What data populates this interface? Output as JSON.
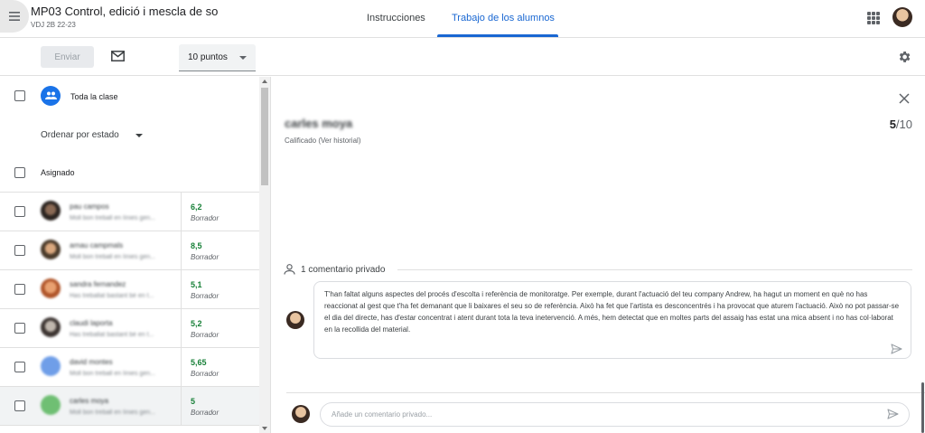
{
  "header": {
    "course_title": "MP03 Control, edició i mescla de so",
    "course_subtitle": "VDJ 2B 22-23",
    "tabs": [
      {
        "label": "Instrucciones",
        "active": false
      },
      {
        "label": "Trabajo de los alumnos",
        "active": true
      }
    ]
  },
  "toolbar": {
    "send_label": "Enviar",
    "points_value": "10 puntos"
  },
  "left_panel": {
    "all_class_label": "Toda la clase",
    "sort_label": "Ordenar por estado",
    "assigned_label": "Asignado",
    "students": [
      {
        "name": "pau campos",
        "preview": "Moll bon treball en línies gen...",
        "grade": "6,2",
        "status": "Borrador",
        "avatar": "a-dark",
        "selected": false
      },
      {
        "name": "arnau campmals",
        "preview": "Moll bon treball en línies gen...",
        "grade": "8,5",
        "status": "Borrador",
        "avatar": "a-warm",
        "selected": false
      },
      {
        "name": "sandra fernandez",
        "preview": "Has treballat bastant bé en t...",
        "grade": "5,1",
        "status": "Borrador",
        "avatar": "a-orange",
        "selected": false
      },
      {
        "name": "claudi laporta",
        "preview": "Has treballat bastant bé en t...",
        "grade": "5,2",
        "status": "Borrador",
        "avatar": "a-gray",
        "selected": false
      },
      {
        "name": "david montes",
        "preview": "Moll bon treball en línies gen...",
        "grade": "5,65",
        "status": "Borrador",
        "avatar": "a-blue",
        "selected": false
      },
      {
        "name": "carles moya",
        "preview": "Moll bon treball en línies gen...",
        "grade": "5",
        "status": "Borrador",
        "avatar": "a-green",
        "selected": true
      }
    ]
  },
  "detail": {
    "student_name": "carles moya",
    "grade_value": "5",
    "grade_total": "/10",
    "status": "Calificado (Ver historial)",
    "comments_header": "1 comentario privado",
    "comment_text": "T'han faltat alguns aspectes del procés d'escolta i referència de monitoratge. Per exemple, durant l'actuació del teu company Andrew, ha hagut un moment en què no has reaccionat al gest que t'ha fet demanant que li baixares el seu so de referència. Això ha fet que l'artista es desconcentrés i ha provocat que aturem l'actuació. Això no pot passar-se el dia del directe, has d'estar concentrat i atent durant tota la teva inetervenció. A més, hem detectat que en moltes parts del assaig has estat una mica absent i no has col·laborat en la recollida del material.",
    "compose_placeholder": "Añade un comentario privado..."
  },
  "colors": {
    "accent": "#1967d2",
    "grade_green": "#188038",
    "class_icon_blue": "#1a73e8"
  }
}
